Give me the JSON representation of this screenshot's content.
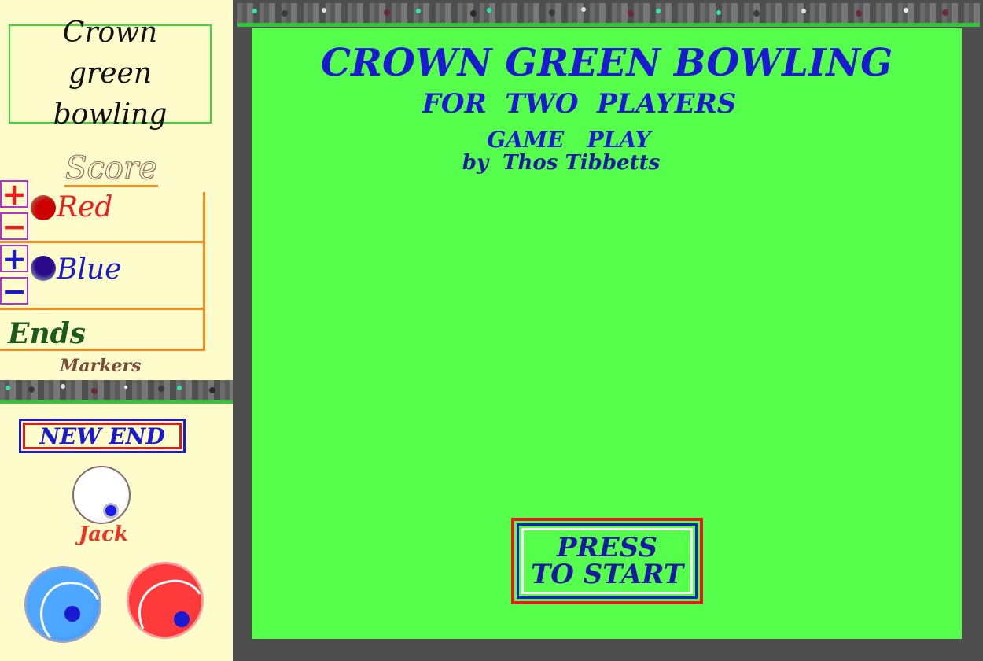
{
  "sidebar": {
    "title": "Crown green bowling",
    "score_heading": "Score",
    "players": [
      {
        "name": "Red",
        "color": "#ee1c1c",
        "ball_color": "#cc1111"
      },
      {
        "name": "Blue",
        "color": "#1a1ad0",
        "ball_color": "#2a1a8a"
      }
    ],
    "plus_symbol": "+",
    "minus_symbol": "−",
    "ends_label": "Ends",
    "markers_label": "Markers",
    "new_end_label": "NEW END",
    "jack_label": "Jack",
    "bowls": [
      {
        "player": "blue",
        "color": "#4da6ff"
      },
      {
        "player": "red",
        "color": "#ff3a3a"
      }
    ]
  },
  "main": {
    "title": "CROWN GREEN BOWLING",
    "subtitle": "FOR  TWO  PLAYERS",
    "mode": "GAME   PLAY",
    "author": "by  Thos Tibbetts",
    "start_button": {
      "line1": "PRESS",
      "line2": "TO START"
    }
  },
  "colors": {
    "green": "#55ff4c",
    "frame": "#4d4d4d",
    "sidebar_bg": "#fffccc",
    "accent_orange": "#f08a1e",
    "text_blue": "#1a1ad0"
  }
}
